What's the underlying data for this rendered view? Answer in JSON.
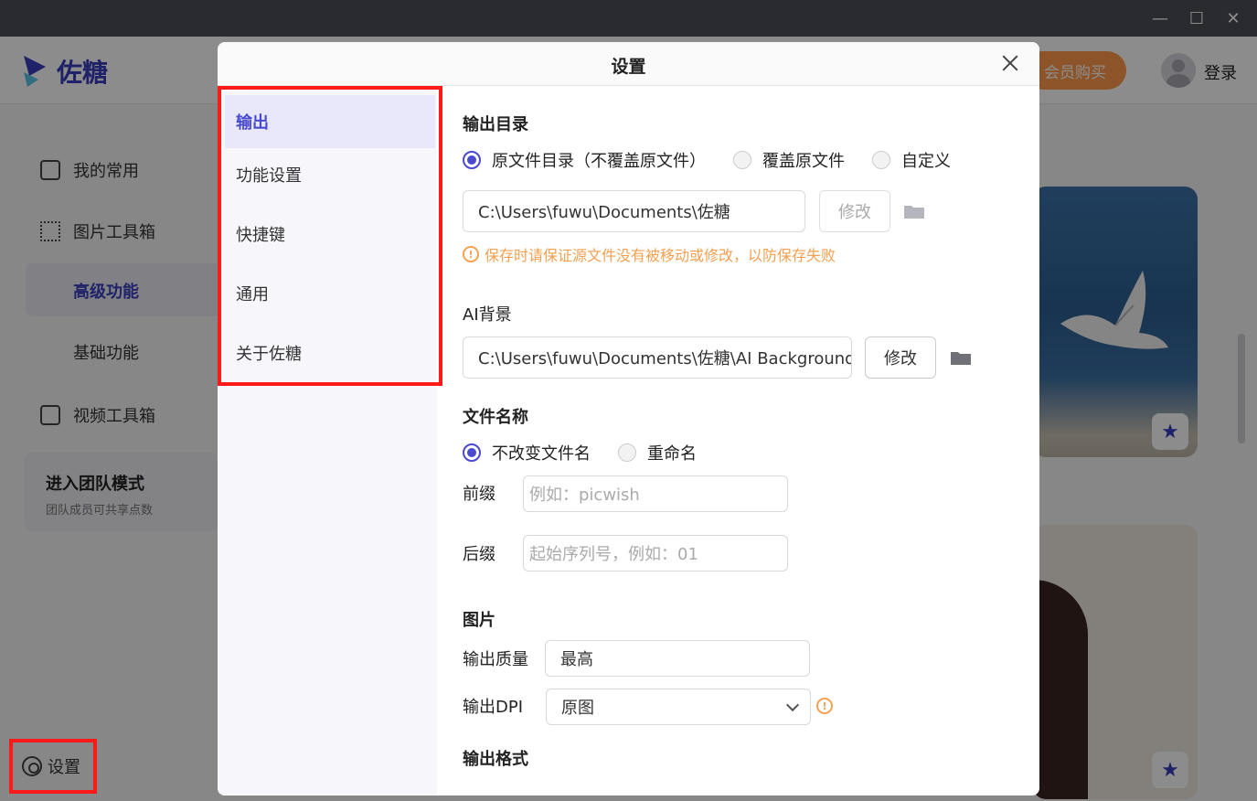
{
  "app": {
    "name": "佐糖",
    "vip_label": "会员购买",
    "login_label": "登录"
  },
  "window": {
    "minimize": "—",
    "maximize": "☐",
    "close": "✕"
  },
  "sidebar": {
    "items": [
      {
        "label": "我的常用",
        "icon": "favorites-icon"
      },
      {
        "label": "图片工具箱",
        "icon": "grid-icon"
      },
      {
        "label": "高级功能"
      },
      {
        "label": "基础功能"
      },
      {
        "label": "视频工具箱",
        "icon": "film-icon"
      }
    ],
    "team_title": "进入团队模式",
    "team_sub": "团队成员可共享点数",
    "settings_label": "设置"
  },
  "modal": {
    "title": "设置",
    "nav": [
      "输出",
      "功能设置",
      "快捷键",
      "通用",
      "关于佐糖"
    ],
    "output_dir": {
      "heading": "输出目录",
      "options": [
        "原文件目录（不覆盖原文件）",
        "覆盖原文件",
        "自定义"
      ],
      "selected": 0,
      "path": "C:\\Users\\fuwu\\Documents\\佐糖",
      "modify": "修改",
      "warning": "保存时请保证源文件没有被移动或修改，以防保存失败"
    },
    "ai_bg": {
      "heading": "AI背景",
      "path": "C:\\Users\\fuwu\\Documents\\佐糖\\AI Background",
      "modify": "修改"
    },
    "filename": {
      "heading": "文件名称",
      "options": [
        "不改变文件名",
        "重命名"
      ],
      "selected": 0,
      "prefix_label": "前缀",
      "prefix_placeholder": "例如：picwish",
      "suffix_label": "后缀",
      "suffix_placeholder": "起始序列号，例如：01"
    },
    "image": {
      "heading": "图片",
      "quality_label": "输出质量",
      "quality_value": "最高",
      "dpi_label": "输出DPI",
      "dpi_value": "原图"
    },
    "format_heading": "输出格式"
  },
  "colors": {
    "accent": "#4a4ad0",
    "warning": "#f5a050",
    "highlight": "#ff1a1a"
  }
}
